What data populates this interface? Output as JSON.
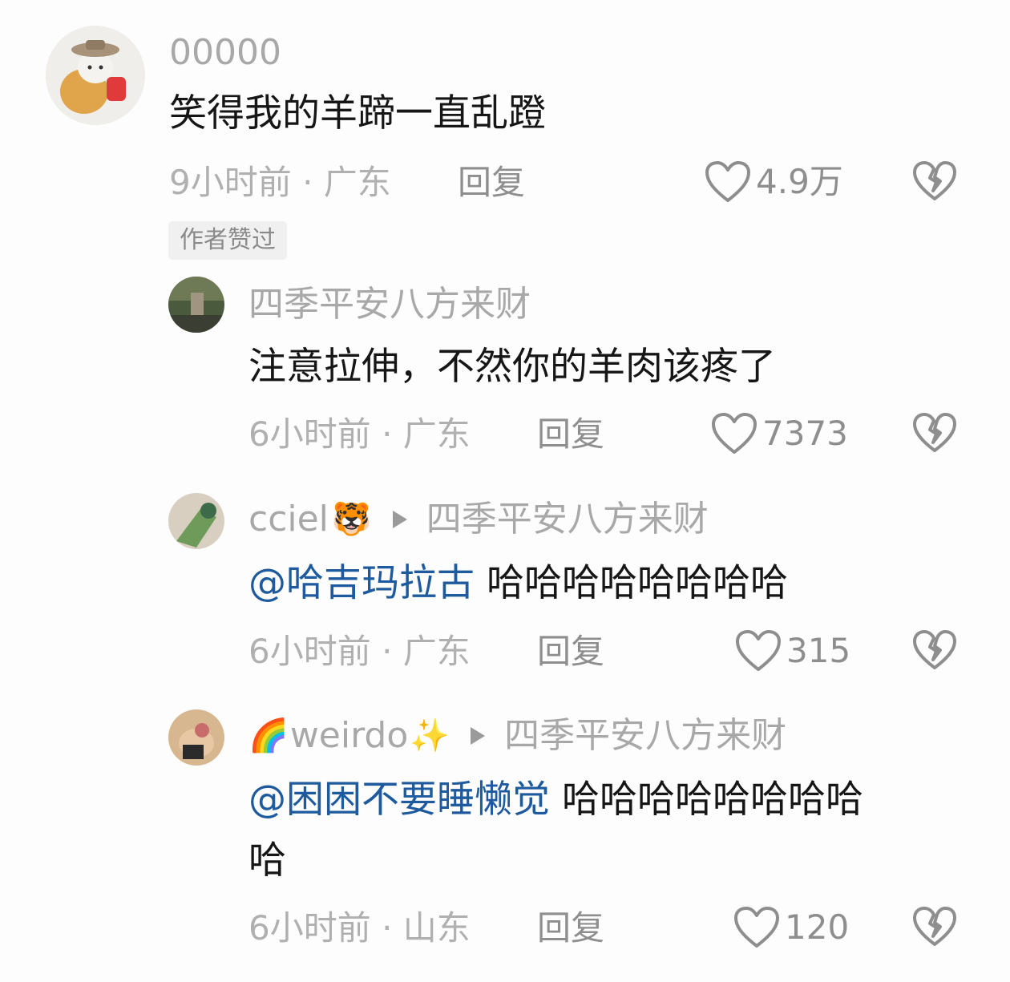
{
  "comment": {
    "username": "00000",
    "text": "笑得我的羊蹄一直乱蹬",
    "time_location": "9小时前 · 广东",
    "reply_label": "回复",
    "likes": "4.9万",
    "badge": "作者赞过"
  },
  "replies": [
    {
      "username": "四季平安八方来财",
      "text": "注意拉伸，不然你的羊肉该疼了",
      "time_location": "6小时前 · 广东",
      "reply_label": "回复",
      "likes": "7373"
    },
    {
      "username": "cciel",
      "username_emoji": "🐯",
      "reply_to": "四季平安八方来财",
      "mention": "@哈吉玛拉古",
      "text": "哈哈哈哈哈哈哈哈",
      "time_location": "6小时前 · 广东",
      "reply_label": "回复",
      "likes": "315"
    },
    {
      "username_emoji_prefix": "🌈",
      "username": "weirdo",
      "username_emoji": "✨",
      "reply_to": "四季平安八方来财",
      "mention": "@困困不要睡懒觉",
      "text": "哈哈哈哈哈哈哈哈",
      "text_line2": "哈",
      "time_location": "6小时前 · 山东",
      "reply_label": "回复",
      "likes": "120"
    }
  ],
  "colors": {
    "mention": "#1e5a9e",
    "text": "#161616",
    "meta": "#b0b0b0",
    "icon": "#8e8e8e"
  }
}
